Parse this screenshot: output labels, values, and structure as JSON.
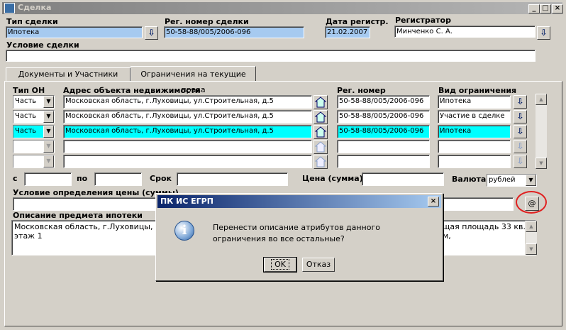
{
  "window": {
    "title": "Сделка",
    "min": "_",
    "max": "□",
    "close": "×"
  },
  "header": {
    "deal_type_label": "Тип сделки",
    "deal_type_value": "Ипотека",
    "reg_number_label": "Рег. номер сделки",
    "reg_number_value": "50-58-88/005/2006-096",
    "reg_date_label": "Дата регистр.",
    "reg_date_value": "21.02.2007",
    "registrar_label": "Регистратор",
    "registrar_value": "Минченко С. А.",
    "condition_label": "Условие сделки",
    "condition_value": ""
  },
  "tabs": [
    {
      "label": "Документы и Участники",
      "active": false
    },
    {
      "label": "Ограничения на текущие права",
      "active": true
    }
  ],
  "grid": {
    "col_type": "Тип ОН",
    "col_address": "Адрес объекта недвижимости",
    "col_reg": "Рег. номер",
    "col_kind": "Вид ограничения",
    "rows": [
      {
        "type": "Часть",
        "address": "Московская область, г.Луховицы, ул.Строительная, д.5",
        "reg": "50-58-88/005/2006-096",
        "kind": "Ипотека",
        "selected": false
      },
      {
        "type": "Часть",
        "address": "Московская область, г.Луховицы, ул.Строительная, д.5",
        "reg": "50-58-88/005/2006-096",
        "kind": "Участие в сделке",
        "selected": false
      },
      {
        "type": "Часть",
        "address": "Московская область, г.Луховицы, ул.Строительная, д.5",
        "reg": "50-58-88/005/2006-096",
        "kind": "Ипотека",
        "selected": true
      },
      {
        "type": "",
        "address": "",
        "reg": "",
        "kind": "",
        "selected": false
      },
      {
        "type": "",
        "address": "",
        "reg": "",
        "kind": "",
        "selected": false
      }
    ]
  },
  "period": {
    "from_label": "с",
    "to_label": "по",
    "term_label": "Срок",
    "price_label": "Цена (сумма)",
    "currency_label": "Валюта",
    "currency_value": "рублей"
  },
  "price_condition_label": "Условие определения цены (суммы)",
  "at_button": "@",
  "description": {
    "label": "Описание предмета ипотеки",
    "text_left": "Московская область, г.Луховицы, ул.С",
    "text_left2": "этаж 1",
    "text_right": "щая площадь 33 кв. м,"
  },
  "dialog": {
    "title": "ПК ИС ЕГРП",
    "message": "Перенести описание атрибутов данного ограничения во все остальные?",
    "ok": "OK",
    "cancel": "Отказ",
    "close": "×",
    "icon": "i"
  },
  "colors": {
    "selected_row": "#00ffff",
    "readonly_field": "#a6caf0",
    "dialog_title": "#0a246a",
    "highlight_circle": "#e02020"
  }
}
